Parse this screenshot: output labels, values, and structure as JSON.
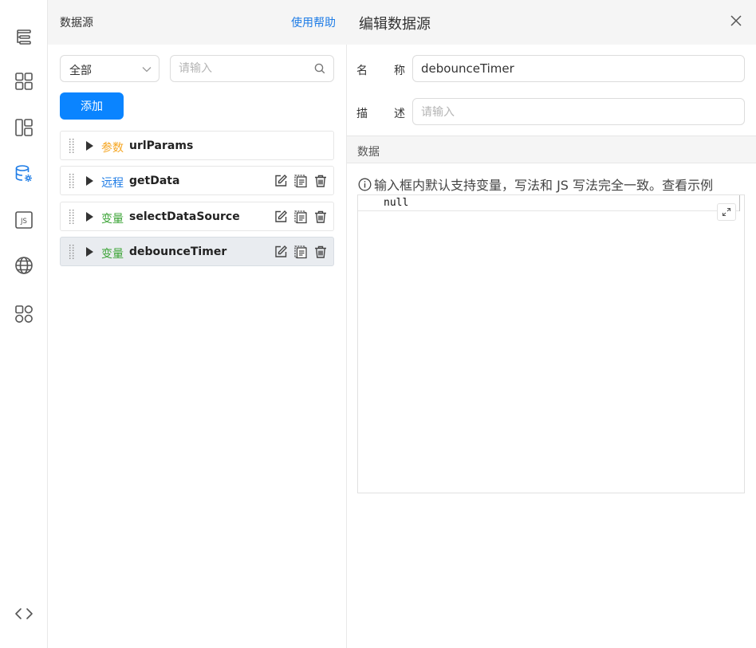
{
  "sidebar": {
    "icons": [
      "outline-tree-icon",
      "components-grid-icon",
      "page-layout-icon",
      "datasource-settings-icon",
      "js-script-icon",
      "globe-icon",
      "plugins-icon",
      "code-brackets-icon"
    ],
    "active_icon": "datasource-settings-icon",
    "accent_color": "#1e7ce6"
  },
  "datasource_panel": {
    "title": "数据源",
    "help_link": "使用帮助",
    "filter": {
      "selected": "全部"
    },
    "search": {
      "placeholder": "请输入"
    },
    "add_button": "添加",
    "items": [
      {
        "tag": "参数",
        "tag_color": "#f5a623",
        "name": "urlParams",
        "actions": false,
        "active": false
      },
      {
        "tag": "远程",
        "tag_color": "#1e7ce6",
        "name": "getData",
        "actions": true,
        "active": false
      },
      {
        "tag": "变量",
        "tag_color": "#3aa335",
        "name": "selectDataSource",
        "actions": true,
        "active": false
      },
      {
        "tag": "变量",
        "tag_color": "#3aa335",
        "name": "debounceTimer",
        "actions": true,
        "active": true
      }
    ]
  },
  "editor": {
    "title": "编辑数据源",
    "name_label": [
      "名",
      "称"
    ],
    "name_value": "debounceTimer",
    "desc_label": [
      "描",
      "述"
    ],
    "desc_placeholder": "请输入",
    "section_title": "数据",
    "hint_text": "输入框内默认支持变量，写法和 JS 写法完全一致。",
    "hint_link": "查看示例",
    "code_value": "null"
  }
}
